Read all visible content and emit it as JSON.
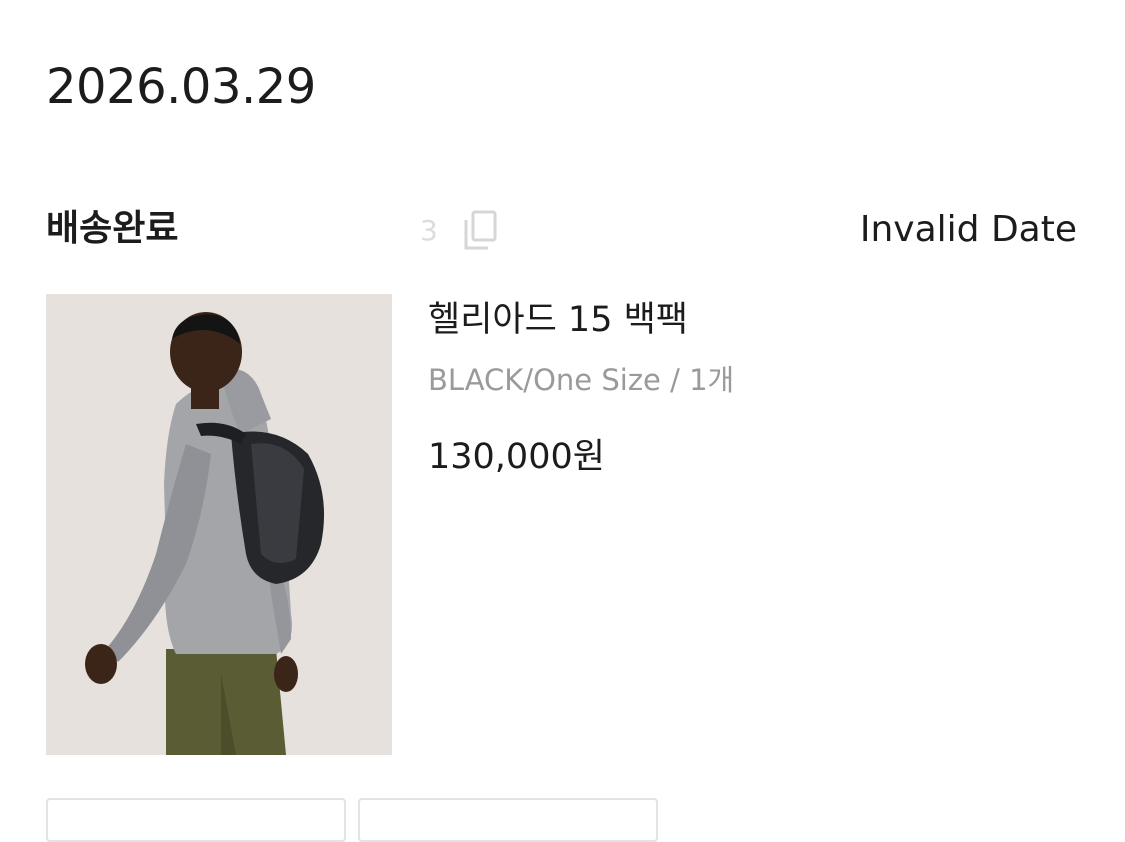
{
  "order": {
    "date": "2026.03.29",
    "status": "배송완료",
    "delivery_date": "Invalid Date",
    "copy_indicator": "3"
  },
  "icons": {
    "copy": "copy-icon"
  },
  "product": {
    "name": "헬리아드 15 백팩",
    "option": "BLACK/One Size / 1개",
    "price": "130,000원",
    "image_alt": "man wearing a gray jacket and black backpack"
  },
  "colors": {
    "text_primary": "#1c1c1c",
    "text_secondary": "#9a9a9a",
    "image_background": "#e6e1dc"
  }
}
